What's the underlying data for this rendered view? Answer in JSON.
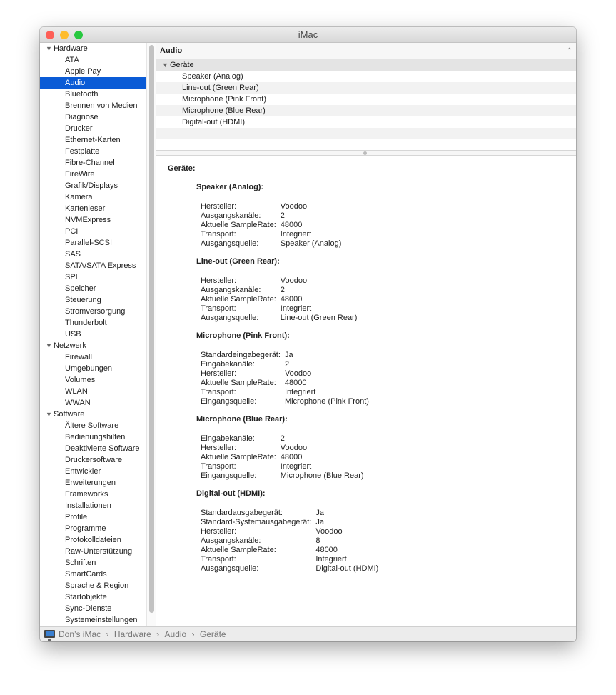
{
  "window": {
    "title": "iMac"
  },
  "sidebar": [
    {
      "label": "Hardware",
      "cat": true
    },
    {
      "label": "ATA"
    },
    {
      "label": "Apple Pay"
    },
    {
      "label": "Audio",
      "selected": true
    },
    {
      "label": "Bluetooth"
    },
    {
      "label": "Brennen von Medien"
    },
    {
      "label": "Diagnose"
    },
    {
      "label": "Drucker"
    },
    {
      "label": "Ethernet-Karten"
    },
    {
      "label": "Festplatte"
    },
    {
      "label": "Fibre-Channel"
    },
    {
      "label": "FireWire"
    },
    {
      "label": "Grafik/Displays"
    },
    {
      "label": "Kamera"
    },
    {
      "label": "Kartenleser"
    },
    {
      "label": "NVMExpress"
    },
    {
      "label": "PCI"
    },
    {
      "label": "Parallel-SCSI"
    },
    {
      "label": "SAS"
    },
    {
      "label": "SATA/SATA Express"
    },
    {
      "label": "SPI"
    },
    {
      "label": "Speicher"
    },
    {
      "label": "Steuerung"
    },
    {
      "label": "Stromversorgung"
    },
    {
      "label": "Thunderbolt"
    },
    {
      "label": "USB"
    },
    {
      "label": "Netzwerk",
      "cat": true
    },
    {
      "label": "Firewall"
    },
    {
      "label": "Umgebungen"
    },
    {
      "label": "Volumes"
    },
    {
      "label": "WLAN"
    },
    {
      "label": "WWAN"
    },
    {
      "label": "Software",
      "cat": true
    },
    {
      "label": "Ältere Software"
    },
    {
      "label": "Bedienungshilfen"
    },
    {
      "label": "Deaktivierte Software"
    },
    {
      "label": "Druckersoftware"
    },
    {
      "label": "Entwickler"
    },
    {
      "label": "Erweiterungen"
    },
    {
      "label": "Frameworks"
    },
    {
      "label": "Installationen"
    },
    {
      "label": "Profile"
    },
    {
      "label": "Programme"
    },
    {
      "label": "Protokolldateien"
    },
    {
      "label": "Raw-Unterstützung"
    },
    {
      "label": "Schriften"
    },
    {
      "label": "SmartCards"
    },
    {
      "label": "Sprache & Region"
    },
    {
      "label": "Startobjekte"
    },
    {
      "label": "Sync-Dienste"
    },
    {
      "label": "Systemeinstellungen"
    }
  ],
  "panel": {
    "title": "Audio",
    "group": "Geräte",
    "items": [
      "Speaker (Analog)",
      "Line-out (Green Rear)",
      "Microphone (Pink Front)",
      "Microphone (Blue Rear)",
      "Digital-out (HDMI)"
    ]
  },
  "detail": {
    "heading": "Geräte:",
    "devices": [
      {
        "title": "Speaker (Analog):",
        "props": [
          [
            "Hersteller:",
            "Voodoo"
          ],
          [
            "Ausgangskanäle:",
            "2"
          ],
          [
            "Aktuelle SampleRate:",
            "48000"
          ],
          [
            "Transport:",
            "Integriert"
          ],
          [
            "Ausgangsquelle:",
            "Speaker (Analog)"
          ]
        ]
      },
      {
        "title": "Line-out (Green Rear):",
        "props": [
          [
            "Hersteller:",
            "Voodoo"
          ],
          [
            "Ausgangskanäle:",
            "2"
          ],
          [
            "Aktuelle SampleRate:",
            "48000"
          ],
          [
            "Transport:",
            "Integriert"
          ],
          [
            "Ausgangsquelle:",
            "Line-out (Green Rear)"
          ]
        ]
      },
      {
        "title": "Microphone (Pink Front):",
        "props": [
          [
            "Standardeingabegerät:",
            "Ja"
          ],
          [
            "Eingabekanäle:",
            "2"
          ],
          [
            "Hersteller:",
            "Voodoo"
          ],
          [
            "Aktuelle SampleRate:",
            "48000"
          ],
          [
            "Transport:",
            "Integriert"
          ],
          [
            "Eingangsquelle:",
            "Microphone (Pink Front)"
          ]
        ]
      },
      {
        "title": "Microphone (Blue Rear):",
        "props": [
          [
            "Eingabekanäle:",
            "2"
          ],
          [
            "Hersteller:",
            "Voodoo"
          ],
          [
            "Aktuelle SampleRate:",
            "48000"
          ],
          [
            "Transport:",
            "Integriert"
          ],
          [
            "Eingangsquelle:",
            "Microphone (Blue Rear)"
          ]
        ]
      },
      {
        "title": "Digital-out (HDMI):",
        "props": [
          [
            "Standardausgabegerät:",
            "Ja"
          ],
          [
            "Standard-Systemausgabegerät:",
            "Ja"
          ],
          [
            "Hersteller:",
            "Voodoo"
          ],
          [
            "Ausgangskanäle:",
            "8"
          ],
          [
            "Aktuelle SampleRate:",
            "48000"
          ],
          [
            "Transport:",
            "Integriert"
          ],
          [
            "Ausgangsquelle:",
            "Digital-out (HDMI)"
          ]
        ]
      }
    ]
  },
  "status": {
    "path": [
      "Don’s iMac",
      "Hardware",
      "Audio",
      "Geräte"
    ]
  }
}
